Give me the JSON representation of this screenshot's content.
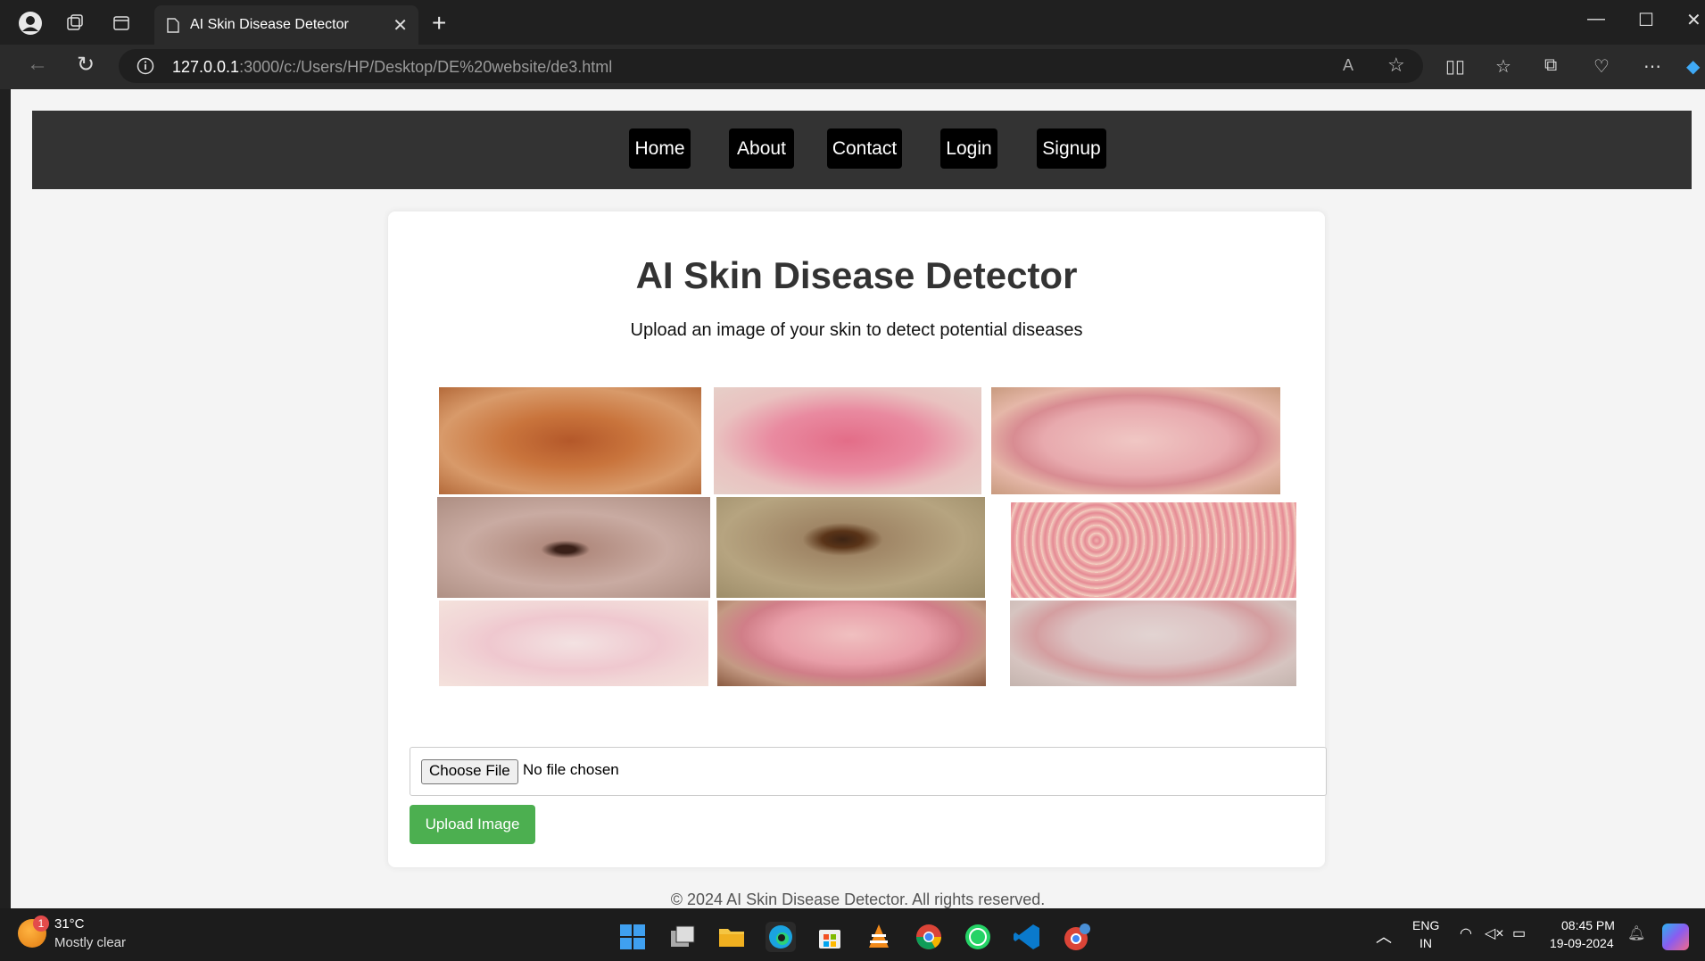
{
  "browser": {
    "tab_title": "AI Skin Disease Detector",
    "url_host": "127.0.0.1",
    "url_rest": ":3000/c:/Users/HP/Desktop/DE%20website/de3.html"
  },
  "nav": {
    "items": [
      {
        "label": "Home"
      },
      {
        "label": "About"
      },
      {
        "label": "Contact"
      },
      {
        "label": "Login"
      },
      {
        "label": "Signup"
      }
    ]
  },
  "main": {
    "title": "AI Skin Disease Detector",
    "subtitle": "Upload an image of your skin to detect potential diseases",
    "choose_file_label": "Choose File",
    "file_status": "No file chosen",
    "upload_button": "Upload Image"
  },
  "footer": {
    "text": "© 2024 AI Skin Disease Detector. All rights reserved."
  },
  "taskbar": {
    "weather_temp": "31°C",
    "weather_desc": "Mostly clear",
    "weather_badge": "1",
    "lang_line1": "ENG",
    "lang_line2": "IN",
    "time": "08:45 PM",
    "date": "19-09-2024"
  },
  "colors": {
    "nav_bg": "#333333",
    "upload_button": "#4caf50",
    "browser_chrome": "#202020"
  }
}
